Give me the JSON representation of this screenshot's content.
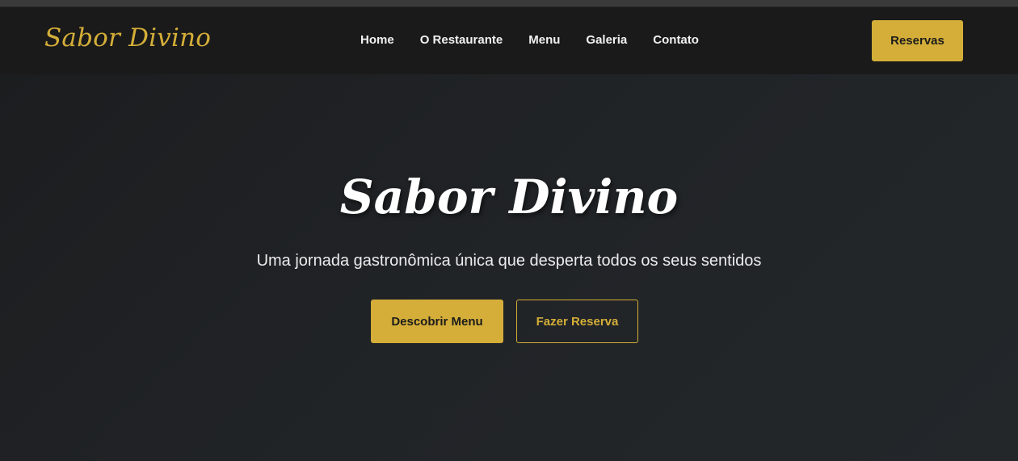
{
  "navbar": {
    "logo": "Sabor Divino",
    "links": [
      {
        "label": "Home"
      },
      {
        "label": "O Restaurante"
      },
      {
        "label": "Menu"
      },
      {
        "label": "Galeria"
      },
      {
        "label": "Contato"
      }
    ],
    "cta_label": "Reservas"
  },
  "hero": {
    "title": "Sabor Divino",
    "subtitle": "Uma jornada gastronômica única que desperta todos os seus sentidos",
    "primary_label": "Descobrir Menu",
    "secondary_label": "Fazer Reserva"
  },
  "colors": {
    "accent": "#d4ae38",
    "navbar_bg": "#1a1a1a",
    "hero_bg": "#212427",
    "text_light": "#ffffff"
  }
}
